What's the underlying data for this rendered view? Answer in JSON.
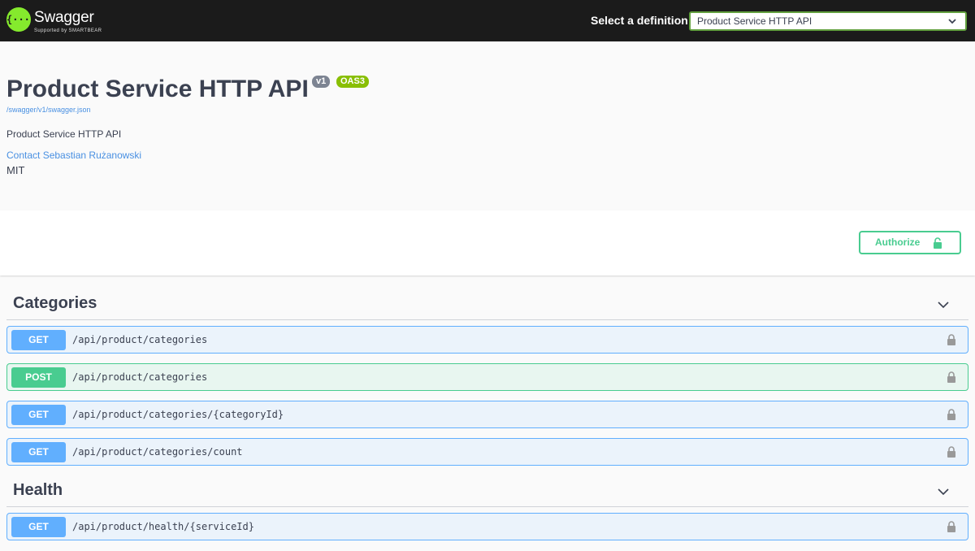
{
  "topbar": {
    "brand": "Swagger",
    "brand_sub": "Supported by SMARTBEAR",
    "logo_glyph": "{···}",
    "select_label": "Select a definition",
    "select_value": "Product Service HTTP API"
  },
  "info": {
    "title": "Product Service HTTP API",
    "version_badge": "v1",
    "oas_badge": "OAS3",
    "spec_url": "/swagger/v1/swagger.json",
    "description": "Product Service HTTP API",
    "contact": "Contact Sebastian Rużanowski",
    "license": "MIT"
  },
  "authorize": {
    "label": "Authorize"
  },
  "sections": [
    {
      "name": "Categories",
      "operations": [
        {
          "method": "GET",
          "path": "/api/product/categories"
        },
        {
          "method": "POST",
          "path": "/api/product/categories"
        },
        {
          "method": "GET",
          "path": "/api/product/categories/{categoryId}"
        },
        {
          "method": "GET",
          "path": "/api/product/categories/count"
        }
      ]
    },
    {
      "name": "Health",
      "operations": [
        {
          "method": "GET",
          "path": "/api/product/health/{serviceId}"
        }
      ]
    }
  ],
  "colors": {
    "get": "#61affe",
    "post": "#49cc90",
    "topbar": "#1b1b1b",
    "brand_green": "#85ea2d"
  }
}
